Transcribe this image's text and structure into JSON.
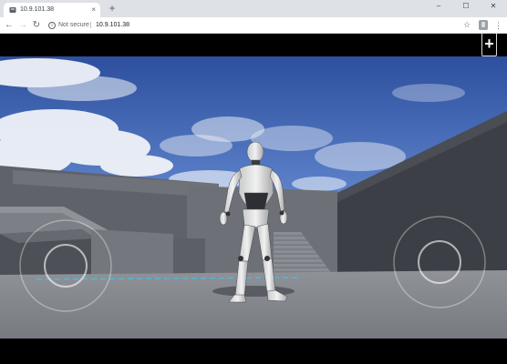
{
  "browser": {
    "tab_title": "10.9.101.38",
    "tab_close": "×",
    "new_tab": "+",
    "window_controls": {
      "minimize": "–",
      "maximize": "☐",
      "close": "✕"
    },
    "nav": {
      "back": "←",
      "forward": "→",
      "reload": "↻"
    },
    "security_label": "Not secure",
    "url": "10.9.101.38",
    "bookmark_star": "☆",
    "menu": "⋮"
  },
  "game": {
    "add_button_label": "+",
    "sky_color": "#3f63b6",
    "floor_color": "#8c8e92",
    "wall_color": "#6b6e74",
    "joystick_color": "#ffffff"
  }
}
